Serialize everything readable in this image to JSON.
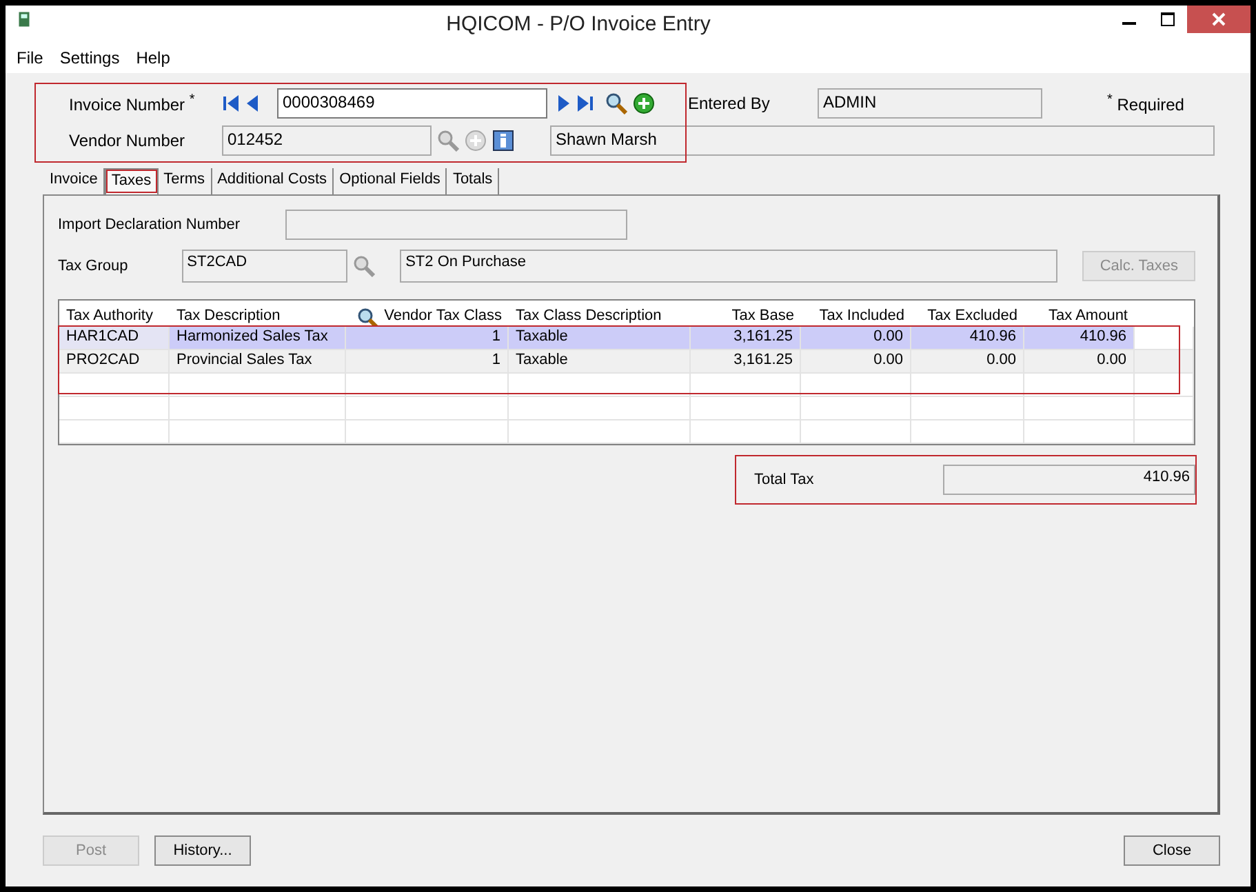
{
  "window": {
    "title": "HQICOM - P/O Invoice Entry"
  },
  "menu": [
    "File",
    "Settings",
    "Help"
  ],
  "header": {
    "highlighted": true,
    "invoice_label": "Invoice Number",
    "invoice_required_mark": "*",
    "invoice_number": "0000308469",
    "vendor_label": "Vendor Number",
    "vendor_number": "012452",
    "vendor_name": "Shawn Marsh",
    "entered_by_label": "Entered By",
    "entered_by": "ADMIN",
    "required_mark": "*",
    "required_label": "Required"
  },
  "tabs": [
    {
      "label": "Invoice",
      "selected": false
    },
    {
      "label": "Taxes",
      "selected": true
    },
    {
      "label": "Terms",
      "selected": false
    },
    {
      "label": "Additional Costs",
      "selected": false
    },
    {
      "label": "Optional Fields",
      "selected": false
    },
    {
      "label": "Totals",
      "selected": false
    }
  ],
  "import_declaration": {
    "label": "Import Declaration Number"
  },
  "tax_group": {
    "label": "Tax Group",
    "code": "ST2CAD",
    "description": "ST2 On Purchase"
  },
  "calc_taxes_button": {
    "label": "Calc. Taxes",
    "disabled": true
  },
  "table": {
    "highlighted": true,
    "columns": [
      "Tax Authority",
      "Tax Description",
      "Vendor Tax Class",
      "Tax Class Description",
      "Tax Base",
      "Tax Included",
      "Tax Excluded",
      "Tax Amount"
    ],
    "rows": [
      {
        "selected": true,
        "cells": [
          "HAR1CAD",
          "Harmonized Sales Tax",
          "1",
          "Taxable",
          "3,161.25",
          "0.00",
          "410.96",
          "410.96"
        ]
      },
      {
        "selected": false,
        "cells": [
          "PRO2CAD",
          "Provincial Sales Tax",
          "1",
          "Taxable",
          "3,161.25",
          "0.00",
          "0.00",
          "0.00"
        ]
      }
    ]
  },
  "total_tax": {
    "highlighted": true,
    "label": "Total Tax",
    "value": "410.96"
  },
  "buttons": [
    {
      "label": "Post",
      "disabled": true
    },
    {
      "label": "History...",
      "disabled": false
    }
  ],
  "close_button": {
    "label": "Close",
    "disabled": false
  }
}
